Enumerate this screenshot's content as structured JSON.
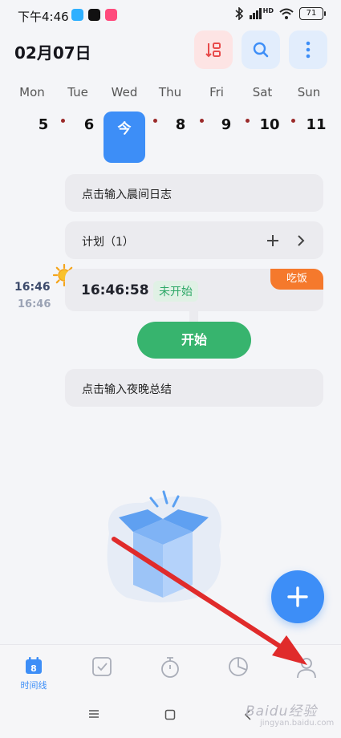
{
  "status_bar": {
    "time": "下午4:46",
    "battery": "71",
    "network": "HD"
  },
  "header": {
    "date": "02月07日",
    "icons": [
      "sort-icon",
      "search-icon",
      "more-vertical-icon"
    ]
  },
  "week": {
    "days": [
      {
        "name": "Mon",
        "num": "5",
        "dot": true
      },
      {
        "name": "Tue",
        "num": "6",
        "dot": true
      },
      {
        "name": "Wed",
        "num": "今",
        "dot": false,
        "today": true
      },
      {
        "name": "Thu",
        "num": "8",
        "dot": true
      },
      {
        "name": "Fri",
        "num": "9",
        "dot": true
      },
      {
        "name": "Sat",
        "num": "10",
        "dot": true
      },
      {
        "name": "Sun",
        "num": "11",
        "dot": false
      }
    ]
  },
  "morning_log": {
    "placeholder": "点击输入晨间日志"
  },
  "plan": {
    "label": "计划（1）"
  },
  "task": {
    "start_time": "16:46",
    "end_time": "16:46",
    "timer": "16:46:58",
    "status": "未开始",
    "tag": "吃饭",
    "start_button": "开始"
  },
  "evening_log": {
    "placeholder": "点击输入夜晚总结"
  },
  "bottom_nav": {
    "items": [
      {
        "label": "时间线",
        "icon": "calendar-icon",
        "badge": "8",
        "active": true
      },
      {
        "label": "",
        "icon": "checklist-icon"
      },
      {
        "label": "",
        "icon": "stopwatch-icon"
      },
      {
        "label": "",
        "icon": "pie-chart-icon"
      },
      {
        "label": "",
        "icon": "profile-icon"
      }
    ]
  },
  "watermark": {
    "text": "Baidu经验",
    "sub": "jingyan.baidu.com"
  },
  "colors": {
    "accent": "#3d8ef7",
    "start": "#37b46e",
    "tag": "#f5792c",
    "arrow": "#e02b2b"
  }
}
